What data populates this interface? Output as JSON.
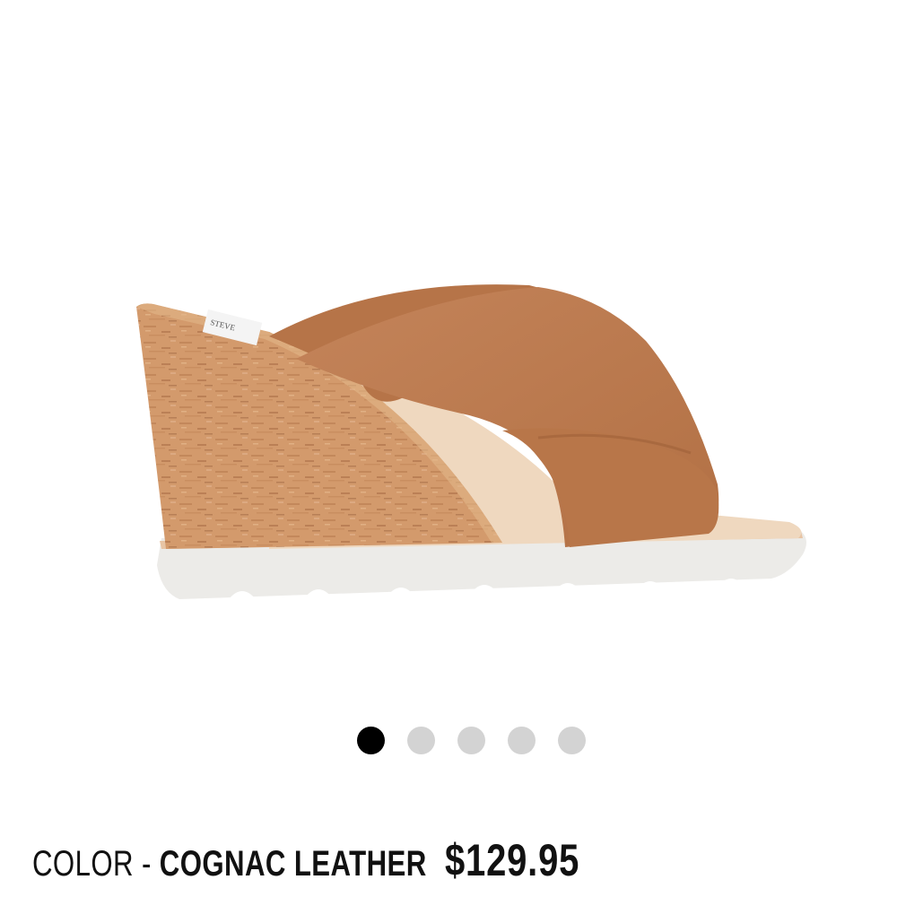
{
  "product": {
    "image_alt": "wedge sandal",
    "color_prefix": "COLOR - ",
    "color_value": "COGNAC LEATHER",
    "price": "$129.95"
  },
  "carousel": {
    "total": 5,
    "active_index": 0
  },
  "colors": {
    "leather": "#b8784a",
    "cork": "#d59a6a",
    "sole": "#e8e6e2",
    "active_dot": "#000000",
    "inactive_dot": "#d3d3d3"
  }
}
